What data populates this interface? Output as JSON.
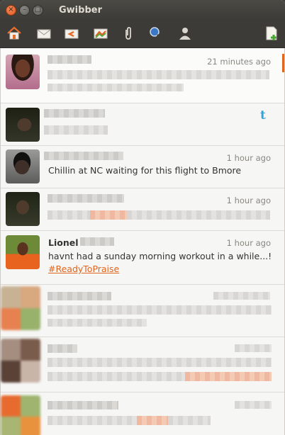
{
  "window": {
    "title": "Gwibber"
  },
  "toolbar": {
    "icons": [
      "home-icon",
      "messages-icon",
      "replies-icon",
      "images-icon",
      "attachments-icon",
      "search-icon",
      "user-icon",
      "compose-icon"
    ]
  },
  "feed": {
    "items": [
      {
        "name": "",
        "time": "21 minutes ago",
        "message": ""
      },
      {
        "name": "",
        "time": "",
        "message": ""
      },
      {
        "name": "",
        "time": "1 hour ago",
        "message": "Chillin at NC waiting for this flight to Bmore"
      },
      {
        "name": "",
        "time": "1 hour ago",
        "message": ""
      },
      {
        "name": "Lionel",
        "time": "1 hour ago",
        "message": "havnt had a sunday morning workout in a while...!",
        "hashtag": "#ReadyToPraise"
      },
      {
        "name": "",
        "time": "",
        "message": ""
      },
      {
        "name": "",
        "time": "",
        "message": ""
      },
      {
        "name": "",
        "time": "",
        "message": ""
      }
    ]
  },
  "colors": {
    "accent": "#e0651f",
    "titlebar": "#3c3b37",
    "twitter": "#2aa6dd"
  }
}
